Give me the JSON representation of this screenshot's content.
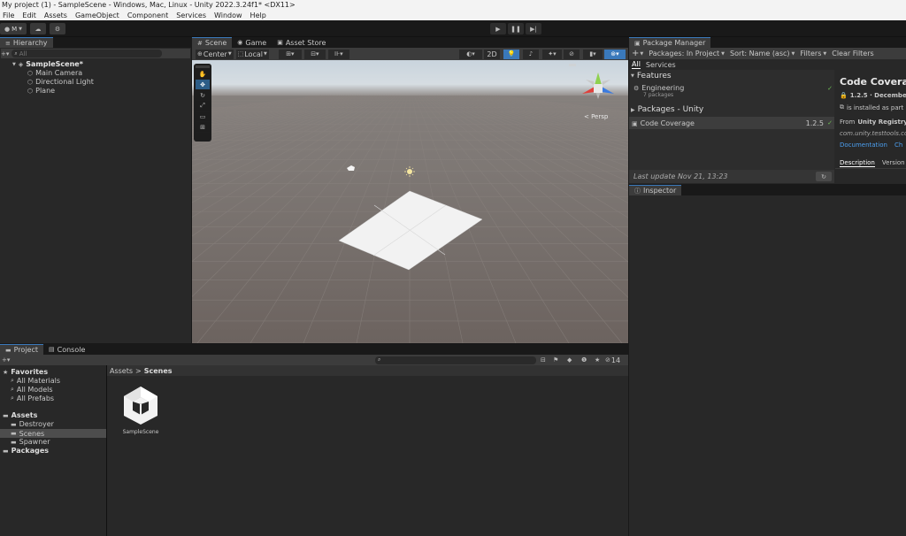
{
  "window": {
    "title": "My project (1) - SampleScene - Windows, Mac, Linux - Unity 2022.3.24f1* <DX11>"
  },
  "menu": [
    "File",
    "Edit",
    "Assets",
    "GameObject",
    "Component",
    "Services",
    "Window",
    "Help"
  ],
  "toolbar": {
    "account_initial": "M",
    "play_icon": "play-icon",
    "pause_icon": "pause-icon",
    "step_icon": "step-icon"
  },
  "hierarchy": {
    "tab": "Hierarchy",
    "search_placeholder": "All",
    "scene": "SampleScene*",
    "items": [
      "Main Camera",
      "Directional Light",
      "Plane"
    ]
  },
  "scene_view": {
    "tabs": [
      "Scene",
      "Game",
      "Asset Store"
    ],
    "pivot": "Center",
    "space": "Local",
    "mode_2d": "2D",
    "persp_label": "< Persp",
    "axis_colors": {
      "x": "#e0413c",
      "y": "#8fd14f",
      "z": "#3b7be0"
    }
  },
  "package_manager": {
    "tab": "Package Manager",
    "add": "+",
    "packages_in": "Packages: In Project",
    "sort": "Sort: Name (asc)",
    "filters": "Filters",
    "clear_filters": "Clear Filters",
    "subtabs": [
      "All",
      "Services"
    ],
    "features_header": "Features",
    "engineering": "Engineering",
    "engineering_count": "7 packages",
    "packages_header": "Packages - Unity",
    "code_coverage": "Code Coverage",
    "code_coverage_version": "1.2.5",
    "last_update": "Last update Nov 21, 13:23",
    "detail_title": "Code Covera",
    "detail_version": "1.2.5 · December 2",
    "installed_note": "is installed as part",
    "from_label": "From",
    "from_value": "Unity Registry b",
    "package_id": "com.unity.testtools.co",
    "documentation_link": "Documentation",
    "changelog_link": "Ch",
    "detail_tabs": [
      "Description",
      "Version"
    ]
  },
  "inspector": {
    "tab": "Inspector"
  },
  "project": {
    "tabs": [
      "Project",
      "Console"
    ],
    "favorites_header": "Favorites",
    "favorites": [
      "All Materials",
      "All Models",
      "All Prefabs"
    ],
    "assets_header": "Assets",
    "asset_folders": [
      "Destroyer",
      "Scenes",
      "Spawner"
    ],
    "packages_header": "Packages",
    "breadcrumb": [
      "Assets",
      "Scenes"
    ],
    "breadcrumb_sep": ">",
    "asset_name": "SampleScene",
    "hidden_count": "14"
  },
  "colors": {
    "accent": "#3a79bb",
    "selection": "#2c5d87",
    "ground": "#6e6561",
    "sky_top": "#c9d4dd"
  }
}
